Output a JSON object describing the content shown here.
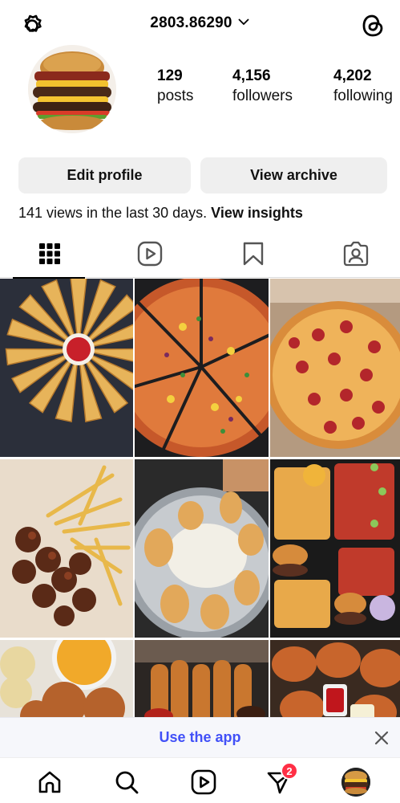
{
  "header": {
    "username": "2803.86290",
    "icons": {
      "left": "settings-gear-icon",
      "right": "threads-icon",
      "dropdown": "chevron-down-icon"
    }
  },
  "profile": {
    "stats": [
      {
        "value": "129",
        "label": "posts"
      },
      {
        "value": "4,156",
        "label": "followers"
      },
      {
        "value": "4,202",
        "label": "following"
      }
    ],
    "buttons": {
      "edit": "Edit profile",
      "archive": "View archive"
    },
    "views_text": "141 views in the last 30 days.",
    "views_link": "View insights"
  },
  "tabs": [
    {
      "name": "grid",
      "icon": "grid-icon",
      "active": true
    },
    {
      "name": "reels",
      "icon": "reels-icon",
      "active": false
    },
    {
      "name": "saved",
      "icon": "bookmark-icon",
      "active": false
    },
    {
      "name": "tagged",
      "icon": "tagged-person-icon",
      "active": false
    }
  ],
  "posts": [
    {
      "subject": "cheesy garlic bread pizza with dip"
    },
    {
      "subject": "pineapple chicken pizza"
    },
    {
      "subject": "pepperoni pizza in box"
    },
    {
      "subject": "boneless wings with fries"
    },
    {
      "subject": "wings platter with dressing"
    },
    {
      "subject": "burgers fries and wings tray"
    },
    {
      "subject": "mac and cheese with fried chicken"
    },
    {
      "subject": "chicken tenders"
    },
    {
      "subject": "fried chicken platter"
    }
  ],
  "banner": {
    "text": "Use the app"
  },
  "bottom_nav": {
    "items": [
      "home-icon",
      "search-icon",
      "reels-icon",
      "activity-icon",
      "profile-avatar"
    ],
    "badge_count": "2"
  },
  "colors": {
    "accent": "#4150f7",
    "badge": "#ff2f45",
    "button_bg": "#efefef"
  }
}
